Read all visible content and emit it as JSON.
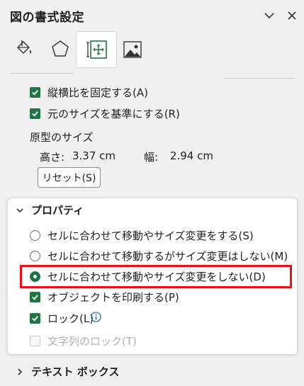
{
  "pane": {
    "title": "図の書式設定"
  },
  "tabs": [
    {
      "name": "fill-line",
      "icon": "paint-bucket-icon"
    },
    {
      "name": "effects",
      "icon": "pentagon-icon"
    },
    {
      "name": "size-properties",
      "icon": "size-properties-icon",
      "selected": true
    },
    {
      "name": "picture",
      "icon": "picture-icon"
    }
  ],
  "size": {
    "lock_aspect_label": "縦横比を固定する(A)",
    "relative_original_label": "元のサイズを基準にする(R)",
    "original_size_heading": "原型のサイズ",
    "height_label": "高さ:",
    "height_value": "3.37 cm",
    "width_label": "幅:",
    "width_value": "2.94 cm",
    "reset_label": "リセット(S)"
  },
  "properties": {
    "heading": "プロパティ",
    "radio_move_size": "セルに合わせて移動やサイズ変更をする(S)",
    "radio_move_only": "セルに合わせて移動するがサイズ変更はしない(M)",
    "radio_none": "セルに合わせて移動やサイズ変更をしない(D)",
    "selected_radio": "radio_none",
    "print_object": "オブジェクトを印刷する(P)",
    "lock": "ロック(L)",
    "lock_text": "文字列のロック(T)"
  },
  "textbox": {
    "heading": "テキスト ボックス"
  },
  "colors": {
    "accent": "#217346",
    "highlight": "#e8101a"
  }
}
